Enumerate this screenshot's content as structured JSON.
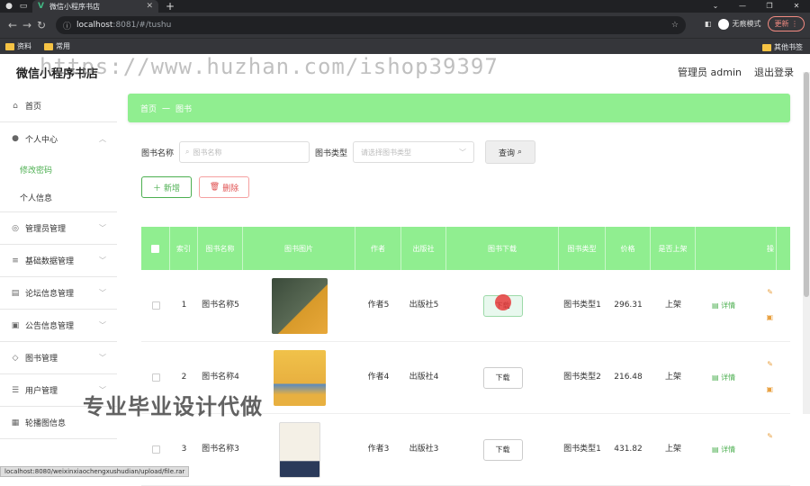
{
  "browser": {
    "tab_title": "微信小程序书店",
    "tab_logo": "V",
    "url_host": "localhost",
    "url_rest": ":8081/#/tushu",
    "incognito_label": "无痕模式",
    "update_label": "更新",
    "bookmarks": [
      "资料",
      "常用"
    ],
    "bookmark_right": "其他书签",
    "icons": [
      "back-icon",
      "forward-icon",
      "reload-icon",
      "info-icon",
      "star-icon",
      "sidepanel-icon",
      "menu-icon"
    ]
  },
  "app": {
    "logo": "微信小程序书店",
    "watermark": "https://www.huzhan.com/ishop39397",
    "admin_label": "管理员 admin",
    "logout_label": "退出登录"
  },
  "sidebar": {
    "items": [
      {
        "label": "首页",
        "icon": "home-icon"
      },
      {
        "label": "个人中心",
        "icon": "user-icon"
      },
      {
        "label": "管理员管理",
        "icon": "admin-icon"
      },
      {
        "label": "基础数据管理",
        "icon": "data-icon"
      },
      {
        "label": "论坛信息管理",
        "icon": "forum-icon"
      },
      {
        "label": "公告信息管理",
        "icon": "notice-icon"
      },
      {
        "label": "图书管理",
        "icon": "book-icon"
      },
      {
        "label": "用户管理",
        "icon": "users-icon"
      },
      {
        "label": "轮播图信息",
        "icon": "carousel-icon"
      }
    ],
    "sub_items": [
      "修改密码",
      "个人信息"
    ]
  },
  "breadcrumb": {
    "home": "首页",
    "sep": "一",
    "current": "图书"
  },
  "search": {
    "name_label": "图书名称",
    "name_placeholder": "图书名称",
    "type_label": "图书类型",
    "type_placeholder": "请选择图书类型",
    "query_label": "查询"
  },
  "actions": {
    "add_label": "新增",
    "delete_label": "删除"
  },
  "table": {
    "headers": [
      "索引",
      "图书名称",
      "图书图片",
      "作者",
      "出版社",
      "图书下载",
      "图书类型",
      "价格",
      "是否上架",
      "操"
    ],
    "rows": [
      {
        "index": "1",
        "name": "图书名称5",
        "author": "作者5",
        "publisher": "出版社5",
        "download": "下载",
        "type": "图书类型1",
        "price": "296.31",
        "shelf": "上架",
        "detail": "详情"
      },
      {
        "index": "2",
        "name": "图书名称4",
        "author": "作者4",
        "publisher": "出版社4",
        "download": "下载",
        "type": "图书类型2",
        "price": "216.48",
        "shelf": "上架",
        "detail": "详情"
      },
      {
        "index": "3",
        "name": "图书名称3",
        "author": "作者3",
        "publisher": "出版社3",
        "download": "下载",
        "type": "图书类型1",
        "price": "431.82",
        "shelf": "上架",
        "detail": "详情"
      }
    ]
  },
  "overlay_text": "专业毕业设计代做",
  "status_url": "localhost:8080/weixinxiaochengxushudian/upload/file.rar"
}
